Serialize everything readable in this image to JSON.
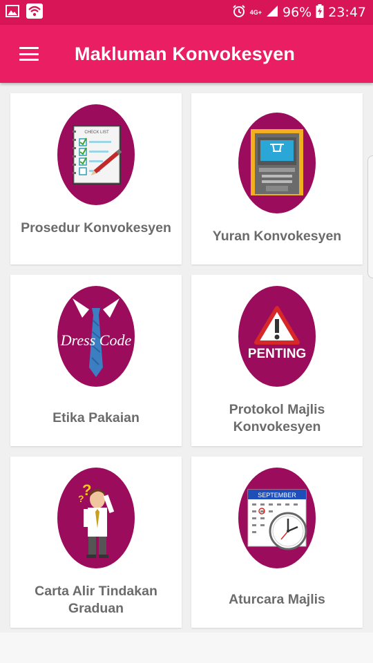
{
  "status_bar": {
    "network": "4G+",
    "battery": "96%",
    "time": "23:47"
  },
  "app_bar": {
    "title": "Makluman Konvokesyen"
  },
  "cards": [
    {
      "label": "Prosedur Konvokesyen",
      "art_text": "CHECK LIST"
    },
    {
      "label": "Yuran Konvokesyen"
    },
    {
      "label": "Etika Pakaian",
      "art_text": "Dress Code"
    },
    {
      "label": "Protokol Majlis Konvokesyen",
      "art_text": "PENTING"
    },
    {
      "label": "Carta Alir Tindakan Graduan"
    },
    {
      "label": "Aturcara Majlis",
      "art_text": "SEPTEMBER"
    }
  ],
  "colors": {
    "status_bar": "#d81556",
    "app_bar": "#e91e63",
    "oval": "#9c0c5c",
    "label": "#6b6b6b"
  }
}
